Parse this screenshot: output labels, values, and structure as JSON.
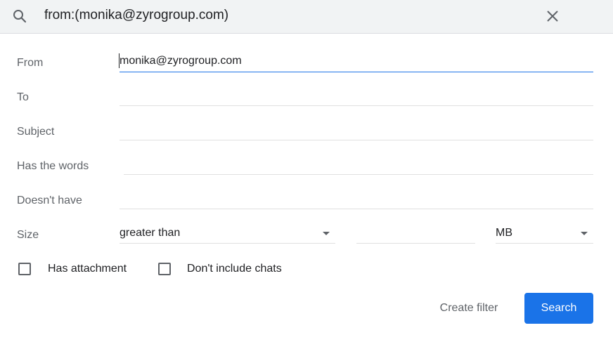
{
  "search": {
    "query": "from:(monika@zyrogroup.com)",
    "search_icon": "search-icon",
    "close_icon": "close-icon"
  },
  "form": {
    "from": {
      "label": "From",
      "value": "monika@zyrogroup.com"
    },
    "to": {
      "label": "To",
      "value": ""
    },
    "subject": {
      "label": "Subject",
      "value": ""
    },
    "has_words": {
      "label": "Has the words",
      "value": ""
    },
    "doesnt_have": {
      "label": "Doesn't have",
      "value": ""
    },
    "size": {
      "label": "Size",
      "comparator": "greater than",
      "value": "",
      "unit": "MB"
    },
    "has_attachment": {
      "label": "Has attachment",
      "checked": false
    },
    "dont_include_chats": {
      "label": "Don't include chats",
      "checked": false
    }
  },
  "actions": {
    "create_filter": "Create filter",
    "search": "Search"
  },
  "colors": {
    "accent": "#1a73e8",
    "search_bar_bg": "#f1f3f4",
    "label": "#5f6368"
  }
}
